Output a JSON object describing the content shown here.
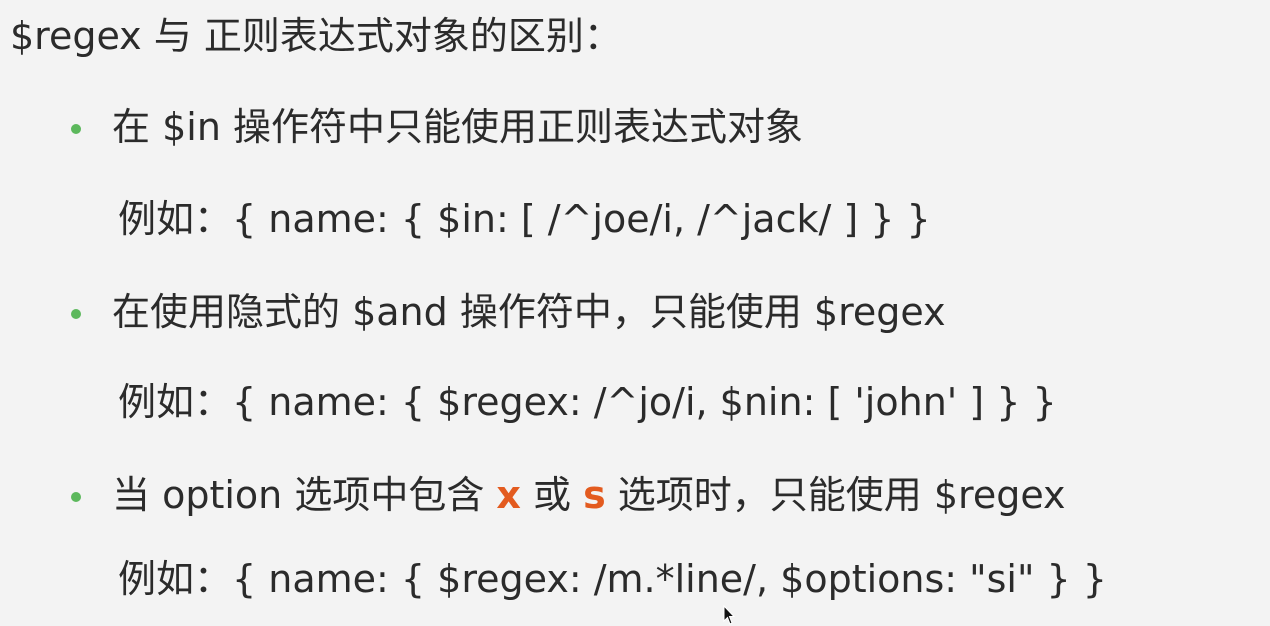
{
  "heading": "$regex 与 正则表达式对象的区别：",
  "colors": {
    "bullet": "#5cb85c",
    "highlight": "#e35b1f",
    "text": "#2b2b2b",
    "background": "#f3f3f3"
  },
  "bullets": [
    {
      "text": "在 $in 操作符中只能使用正则表达式对象",
      "example": "例如：{ name: { $in: [ /^joe/i, /^jack/ ] } }"
    },
    {
      "text": "在使用隐式的 $and 操作符中，只能使用 $regex",
      "example": "例如：{ name: { $regex: /^jo/i,  $nin: [ 'john' ] } }"
    },
    {
      "text_before": "当 option 选项中包含 ",
      "hl1": "x",
      "text_mid": " 或 ",
      "hl2": "s",
      "text_after": " 选项时，只能使用 $regex",
      "example": "例如：{ name: { $regex: /m.*line/, $options: \"si\" } }"
    }
  ],
  "cursor_icon": "mouse-pointer-icon"
}
